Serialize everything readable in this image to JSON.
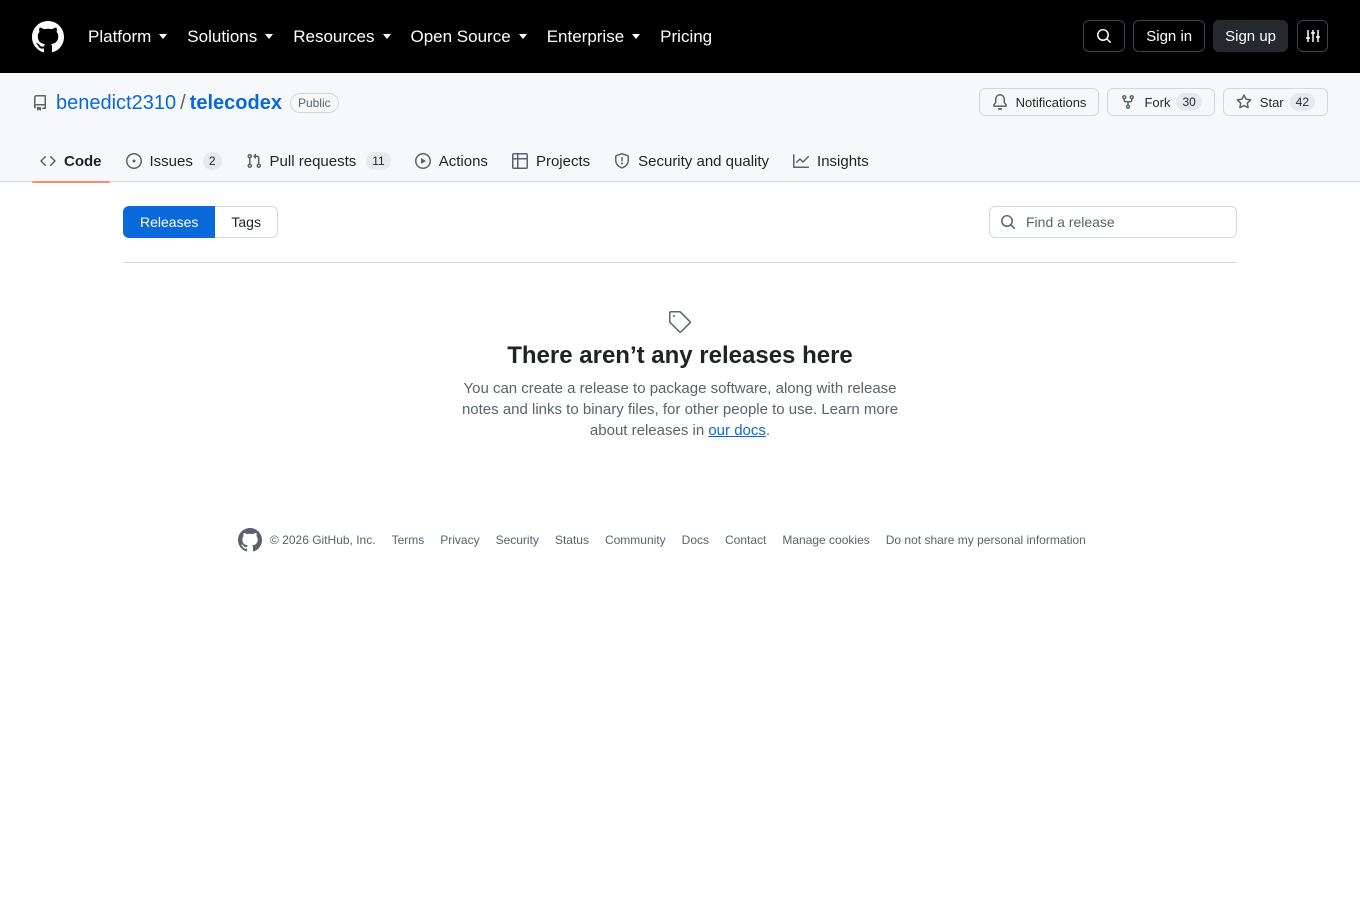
{
  "header": {
    "nav": [
      {
        "label": "Platform",
        "has_caret": true
      },
      {
        "label": "Solutions",
        "has_caret": true
      },
      {
        "label": "Resources",
        "has_caret": true
      },
      {
        "label": "Open Source",
        "has_caret": true
      },
      {
        "label": "Enterprise",
        "has_caret": true
      },
      {
        "label": "Pricing",
        "has_caret": false
      }
    ],
    "sign_in": "Sign in",
    "sign_up": "Sign up"
  },
  "repo": {
    "owner": "benedict2310",
    "separator": "/",
    "name": "telecodex",
    "visibility": "Public",
    "notifications": "Notifications",
    "fork_label": "Fork",
    "fork_count": "30",
    "star_label": "Star",
    "star_count": "42"
  },
  "tabs": [
    {
      "label": "Code",
      "icon": "code-icon",
      "selected": true
    },
    {
      "label": "Issues",
      "icon": "issue-icon",
      "count": "2"
    },
    {
      "label": "Pull requests",
      "icon": "pull-request-icon",
      "count": "11"
    },
    {
      "label": "Actions",
      "icon": "play-icon"
    },
    {
      "label": "Projects",
      "icon": "table-icon"
    },
    {
      "label": "Security and quality",
      "icon": "shield-icon"
    },
    {
      "label": "Insights",
      "icon": "graph-icon"
    }
  ],
  "subnav": {
    "releases": "Releases",
    "tags": "Tags",
    "search_placeholder": "Find a release"
  },
  "blankslate": {
    "title": "There aren’t any releases here",
    "body": "You can create a release to package software, along with release notes and links to binary files, for other people to use. Learn more about releases in ",
    "link": "our docs",
    "end": "."
  },
  "footer": {
    "copyright": "© 2026 GitHub, Inc.",
    "links": [
      "Terms",
      "Privacy",
      "Security",
      "Status",
      "Community",
      "Docs",
      "Contact",
      "Manage cookies",
      "Do not share my personal information"
    ]
  },
  "colors": {
    "accent": "#0969da",
    "tab_underline": "#fd8c73",
    "topbar": "#000000"
  }
}
